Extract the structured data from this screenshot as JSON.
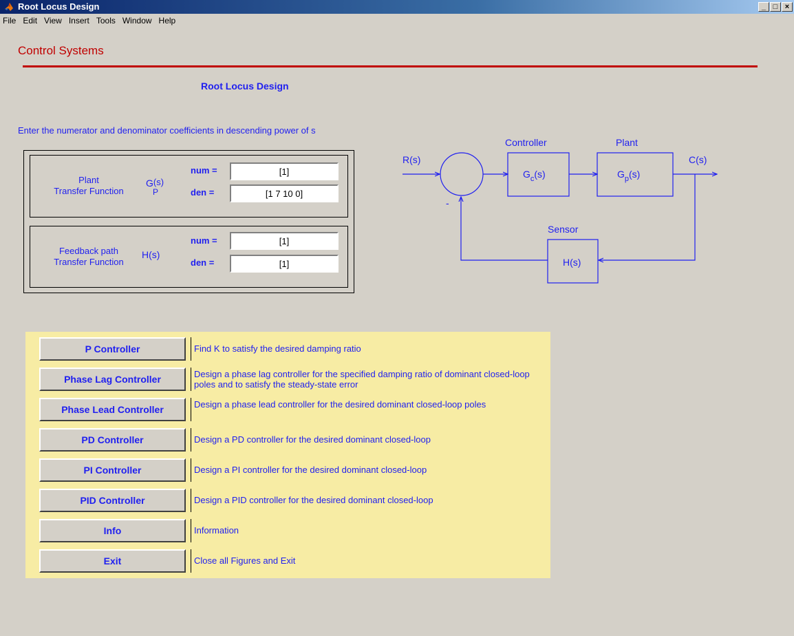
{
  "window": {
    "title": "Root Locus Design",
    "minimize": "_",
    "maximize": "□",
    "close": "×"
  },
  "menu": [
    "File",
    "Edit",
    "View",
    "Insert",
    "Tools",
    "Window",
    "Help"
  ],
  "brand": "Control Systems",
  "heading": "Root Locus Design",
  "instruction": "Enter the numerator and denominator coefficients in descending power of s",
  "plant": {
    "label_line1": "Plant",
    "label_line2": "Transfer Function",
    "symbol_main": "G",
    "symbol_sub": "P",
    "symbol_arg": "(s)",
    "num_label": "num =",
    "num_value": "[1]",
    "den_label": "den =",
    "den_value": "[1 7 10 0]"
  },
  "feedback": {
    "label_line1": "Feedback path",
    "label_line2": "Transfer Function",
    "symbol": "H(s)",
    "num_label": "num =",
    "num_value": "[1]",
    "den_label": "den =",
    "den_value": "[1]"
  },
  "diagram": {
    "input": "R(s)",
    "output": "C(s)",
    "minus": "-",
    "controller_title": "Controller",
    "controller_main": "G",
    "controller_sub": "c",
    "plant_title": "Plant",
    "plant_main": "G",
    "plant_sub": "p",
    "arg": "(s)",
    "sensor_title": "Sensor",
    "sensor_block": "H(s)"
  },
  "controllers": [
    {
      "label": "P Controller",
      "desc": "Find K to satisfy the desired damping ratio"
    },
    {
      "label": "Phase Lag Controller",
      "desc": "Design a phase lag controller for the specified damping ratio of dominant closed-loop poles and to satisfy the steady-state error"
    },
    {
      "label": "Phase Lead Controller",
      "desc": "Design a phase lead controller for the desired dominant closed-loop poles"
    },
    {
      "label": "PD Controller",
      "desc": "Design a PD controller for the desired dominant closed-loop"
    },
    {
      "label": "PI Controller",
      "desc": "Design a PI controller for the desired dominant closed-loop"
    },
    {
      "label": "PID Controller",
      "desc": "Design a PID controller for the desired dominant closed-loop"
    },
    {
      "label": "Info",
      "desc": "Information"
    },
    {
      "label": "Exit",
      "desc": "Close all Figures and Exit"
    }
  ],
  "colors": {
    "accent_text": "#1f1ff0",
    "brand_red": "#c00000",
    "panel_yellow": "#f7eca4",
    "background": "#d4d0c8"
  }
}
